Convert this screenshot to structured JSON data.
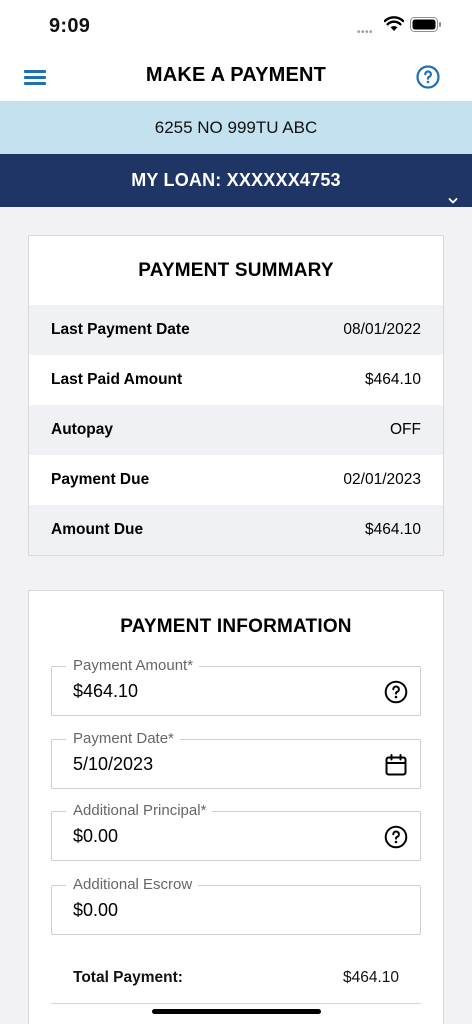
{
  "status_bar": {
    "time": "9:09"
  },
  "header": {
    "title": "MAKE A PAYMENT"
  },
  "address": "6255 NO 999TU ABC",
  "loan": {
    "label": "MY LOAN: XXXXXX4753"
  },
  "summary": {
    "title": "PAYMENT SUMMARY",
    "rows": [
      {
        "label": "Last Payment Date",
        "value": "08/01/2022"
      },
      {
        "label": "Last Paid Amount",
        "value": "$464.10"
      },
      {
        "label": "Autopay",
        "value": "OFF"
      },
      {
        "label": "Payment Due",
        "value": "02/01/2023"
      },
      {
        "label": "Amount Due",
        "value": "$464.10"
      }
    ]
  },
  "payment_info": {
    "title": "PAYMENT INFORMATION",
    "fields": [
      {
        "label": "Payment Amount*",
        "value": "$464.10",
        "icon": "help-circle-icon"
      },
      {
        "label": "Payment Date*",
        "value": "5/10/2023",
        "icon": "calendar-icon"
      },
      {
        "label": "Additional Principal*",
        "value": "$0.00",
        "icon": "help-circle-icon"
      },
      {
        "label": "Additional Escrow",
        "value": "$0.00",
        "icon": ""
      }
    ],
    "total_label": "Total Payment:",
    "total_value": "$464.10"
  },
  "colors": {
    "loan_bar": "#1e3566",
    "address_banner": "#c4e1ef",
    "accent_icon": "#1f6fb5"
  }
}
